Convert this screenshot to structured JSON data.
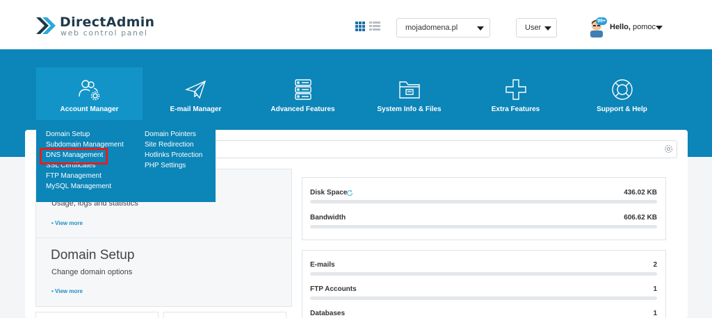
{
  "brand": {
    "name": "DirectAdmin",
    "tagline": "web control panel"
  },
  "header": {
    "domain_select": {
      "value": "mojadomena.pl"
    },
    "level_select": {
      "value": "User"
    },
    "user": {
      "badge": "99+",
      "greeting": "Hello,",
      "username": "pomoc"
    }
  },
  "nav": {
    "items": [
      {
        "label": "Account Manager",
        "icon": "users-gear-icon"
      },
      {
        "label": "E-mail Manager",
        "icon": "paper-plane-icon"
      },
      {
        "label": "Advanced Features",
        "icon": "server-icon"
      },
      {
        "label": "System Info & Files",
        "icon": "folder-icon"
      },
      {
        "label": "Extra Features",
        "icon": "plus-icon"
      },
      {
        "label": "Support & Help",
        "icon": "lifebuoy-icon"
      }
    ]
  },
  "dropdown": {
    "col1": [
      "Domain Setup",
      "Subdomain Management",
      "DNS Management",
      "SSL Certificates",
      "FTP Management",
      "MySQL Management"
    ],
    "col2": [
      "Domain Pointers",
      "Site Redirection",
      "Hotlinks Protection",
      "PHP Settings"
    ],
    "highlighted": "DNS Management"
  },
  "panels": [
    {
      "title": "",
      "subtitle": "Usage, logs and statistics",
      "link": "• View more"
    },
    {
      "title": "Domain Setup",
      "subtitle": "Change domain options",
      "link": "• View more"
    }
  ],
  "stats": {
    "usage": [
      {
        "label": "Disk Space",
        "value": "436.02 KB"
      },
      {
        "label": "Bandwidth",
        "value": "606.62 KB"
      }
    ],
    "counts": [
      {
        "label": "E-mails",
        "value": "2"
      },
      {
        "label": "FTP Accounts",
        "value": "1"
      },
      {
        "label": "Databases",
        "value": "1"
      }
    ]
  },
  "colors": {
    "brand_blue": "#0c85b8",
    "highlight": "#e02020"
  }
}
